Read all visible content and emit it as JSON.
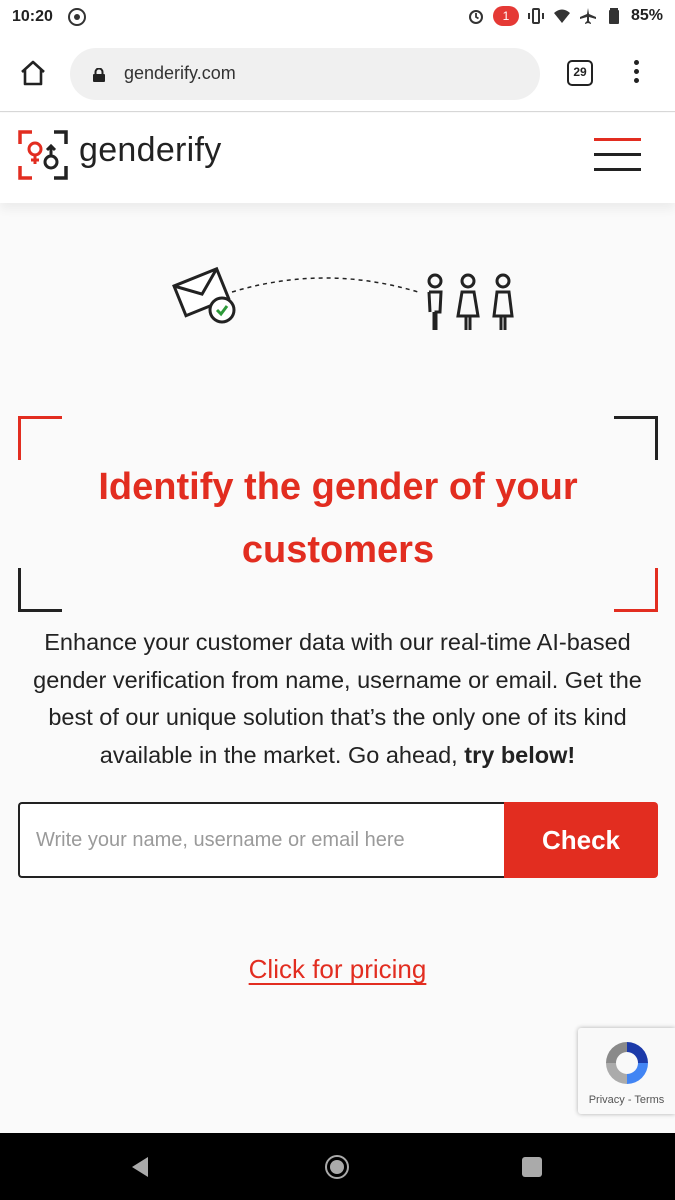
{
  "status_bar": {
    "time": "10:20",
    "notification_count": "1",
    "battery": "85%"
  },
  "browser": {
    "url": "genderify.com",
    "tab_count": "29"
  },
  "site": {
    "logo_text": "genderify"
  },
  "hero": {
    "title": "Identify the gender of your customers",
    "description": "Enhance your customer data with our real-time AI-based gender verification from name, username or email. Get the best of our unique solution that’s the only one of its kind available in the market. Go ahead,",
    "description_emphasis": "try below!"
  },
  "form": {
    "input_placeholder": "Write your name, username or email here",
    "input_value": "",
    "check_label": "Check"
  },
  "pricing_link": "Click for pricing",
  "recaptcha": {
    "links": "Privacy - Terms"
  },
  "colors": {
    "accent": "#e22d20",
    "dark": "#222222"
  }
}
